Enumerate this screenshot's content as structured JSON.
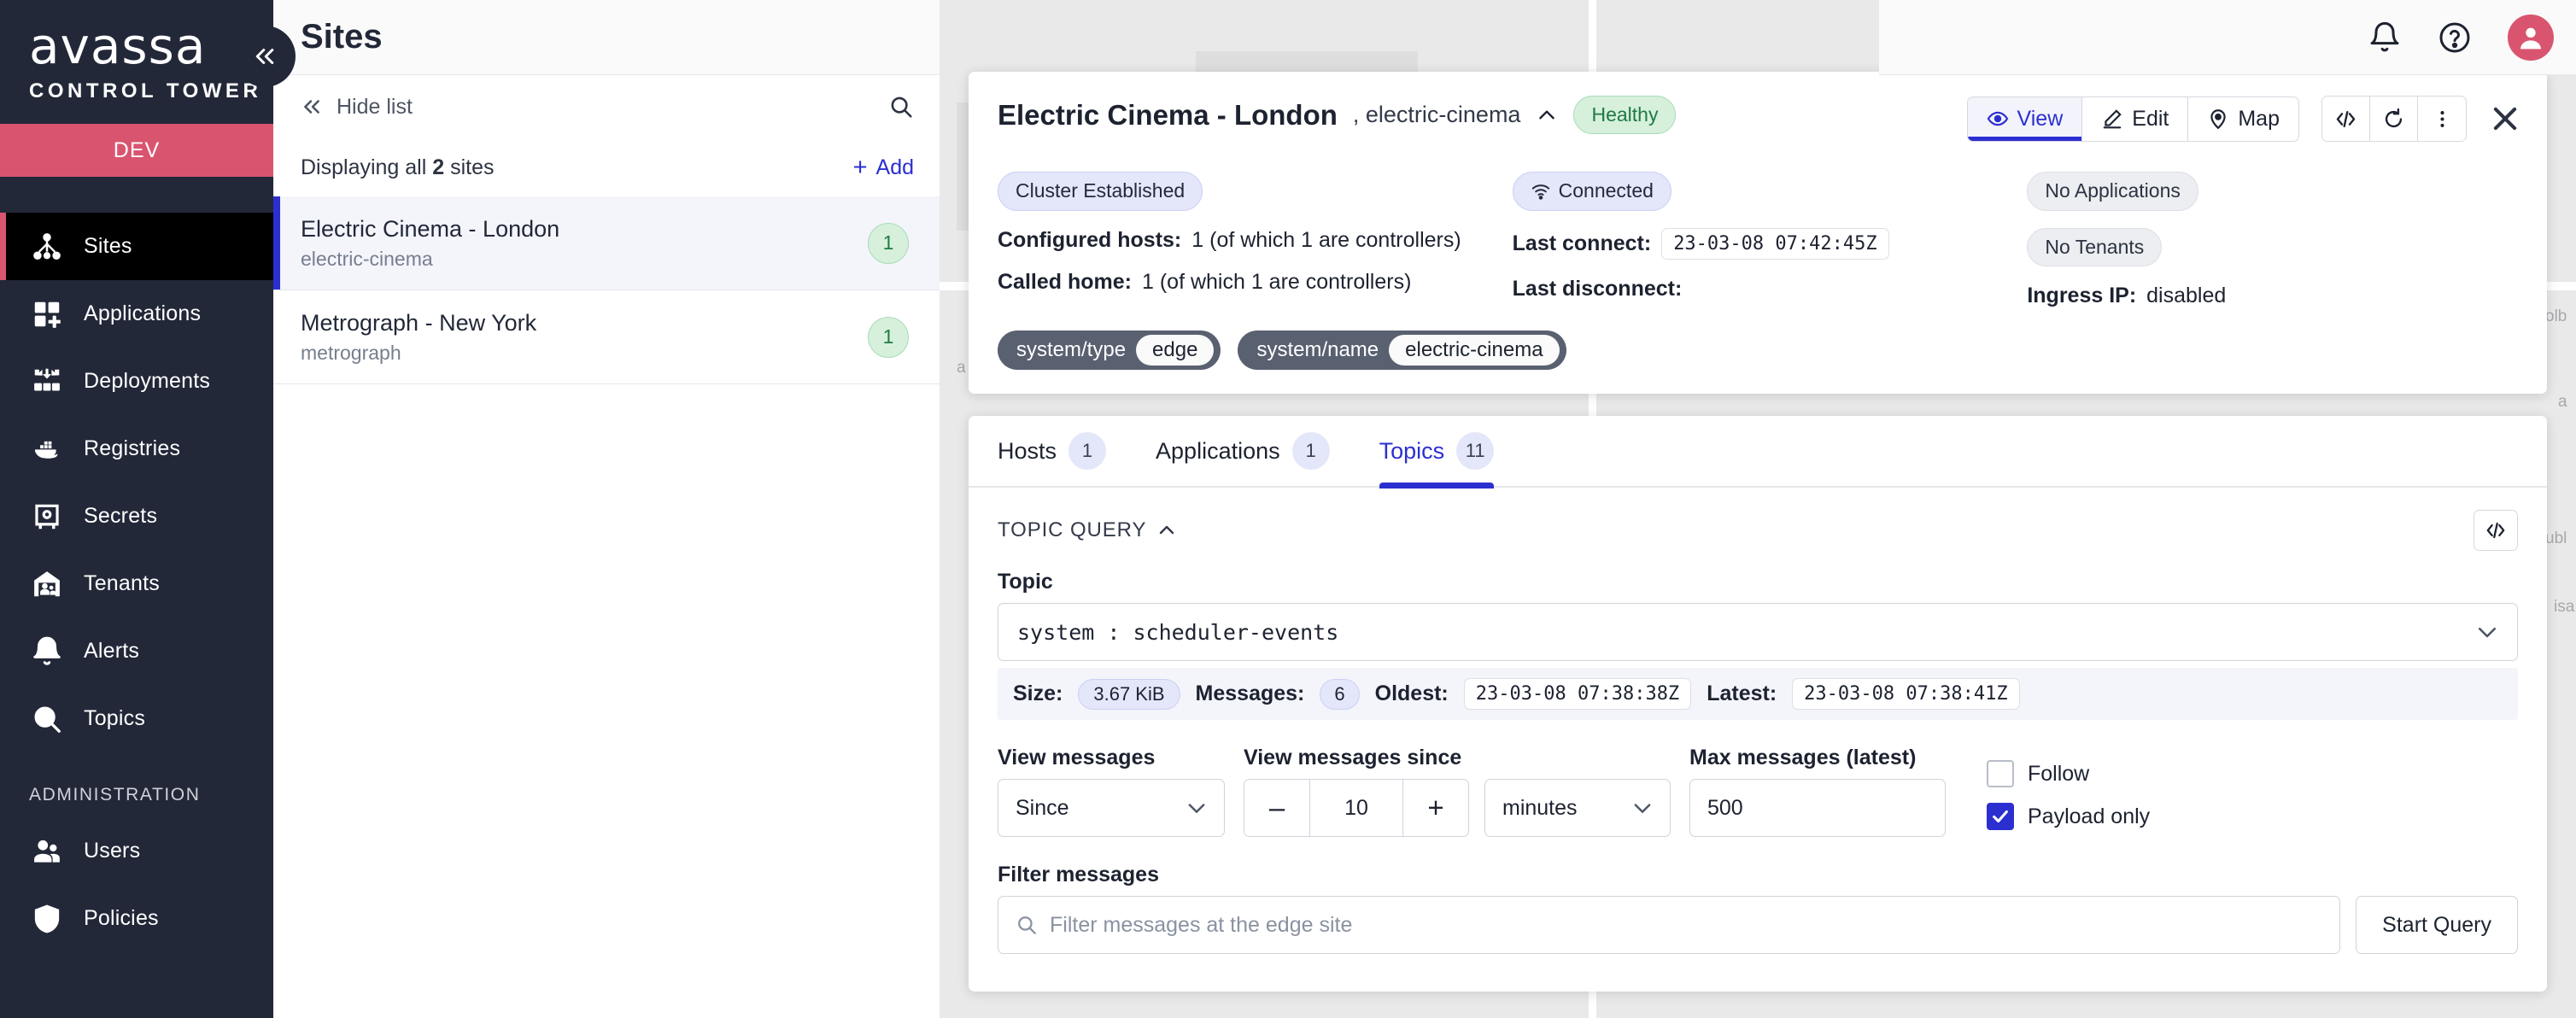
{
  "brand": {
    "logo_word": "avassa",
    "logo_sub": "CONTROL TOWER",
    "env": "DEV",
    "collapse_icon": "chevron-double-left-icon"
  },
  "sidebar": {
    "items": [
      {
        "label": "Sites",
        "icon": "sites-icon",
        "active": true
      },
      {
        "label": "Applications",
        "icon": "applications-icon",
        "active": false
      },
      {
        "label": "Deployments",
        "icon": "deployments-icon",
        "active": false
      },
      {
        "label": "Registries",
        "icon": "docker-whale-icon",
        "active": false
      },
      {
        "label": "Secrets",
        "icon": "safe-icon",
        "active": false
      },
      {
        "label": "Tenants",
        "icon": "tenants-icon",
        "active": false
      },
      {
        "label": "Alerts",
        "icon": "bell-icon",
        "active": false
      },
      {
        "label": "Topics",
        "icon": "magnifier-icon",
        "active": false
      }
    ],
    "admin_heading": "ADMINISTRATION",
    "admin_items": [
      {
        "label": "Users",
        "icon": "users-icon"
      },
      {
        "label": "Policies",
        "icon": "shield-search-icon"
      }
    ]
  },
  "header": {
    "title": "Sites",
    "notifications_icon": "bell-icon",
    "help_icon": "question-circle-icon",
    "avatar_icon": "user-avatar-icon"
  },
  "list_pane": {
    "hide_list_label": "Hide list",
    "hide_list_icon": "chevron-double-left-icon",
    "search_icon": "search-icon",
    "displaying_prefix": "Displaying all",
    "displaying_count": "2",
    "displaying_suffix": "sites",
    "add_label": "Add",
    "add_icon": "plus-icon",
    "rows": [
      {
        "name": "Electric Cinema - London",
        "slug": "electric-cinema",
        "badge": "1",
        "selected": true
      },
      {
        "name": "Metrograph - New York",
        "slug": "metrograph",
        "badge": "1",
        "selected": false
      }
    ]
  },
  "detail": {
    "title": "Electric Cinema - London",
    "subtitle": ", electric-cinema",
    "collapse_icon": "chevron-up-icon",
    "status_badge": "Healthy",
    "actions": {
      "view_label": "View",
      "view_icon": "eye-icon",
      "edit_label": "Edit",
      "edit_icon": "pencil-icon",
      "map_label": "Map",
      "map_icon": "map-pin-icon",
      "code_icon": "code-brackets-icon",
      "refresh_icon": "refresh-icon",
      "kebab_icon": "dots-vertical-icon",
      "close_icon": "close-icon"
    },
    "col1": {
      "pill": "Cluster Established",
      "configured_hosts_key": "Configured hosts:",
      "configured_hosts_value": "1 (of which 1 are controllers)",
      "called_home_key": "Called home:",
      "called_home_value": "1 (of which 1 are controllers)"
    },
    "col2": {
      "pill": "Connected",
      "pill_icon": "wifi-icon",
      "last_connect_key": "Last connect:",
      "last_connect_value": "23-03-08 07:42:45Z",
      "last_disconnect_key": "Last disconnect:",
      "last_disconnect_value": ""
    },
    "col3": {
      "pill_apps": "No Applications",
      "pill_tenants": "No Tenants",
      "ingress_key": "Ingress IP:",
      "ingress_value": "disabled"
    },
    "tags": [
      {
        "key": "system/type",
        "value": "edge"
      },
      {
        "key": "system/name",
        "value": "electric-cinema"
      }
    ]
  },
  "tabs": [
    {
      "label": "Hosts",
      "badge": "1",
      "active": false
    },
    {
      "label": "Applications",
      "badge": "1",
      "active": false
    },
    {
      "label": "Topics",
      "badge": "11",
      "active": true
    }
  ],
  "topic_query": {
    "section_title": "TOPIC QUERY",
    "section_chevron_icon": "chevron-up-icon",
    "code_icon": "code-brackets-icon",
    "topic_label": "Topic",
    "topic_value": "system : scheduler-events",
    "topic_chevron_icon": "chevron-down-icon",
    "stats": {
      "size_key": "Size:",
      "size_value": "3.67 KiB",
      "messages_key": "Messages:",
      "messages_value": "6",
      "oldest_key": "Oldest:",
      "oldest_value": "23-03-08 07:38:38Z",
      "latest_key": "Latest:",
      "latest_value": "23-03-08 07:38:41Z"
    },
    "view_messages_label": "View messages",
    "view_messages_value": "Since",
    "view_since_label": "View messages since",
    "step_minus": "–",
    "step_value": "10",
    "step_plus": "+",
    "unit_value": "minutes",
    "max_messages_label": "Max messages (latest)",
    "max_messages_value": "500",
    "follow_label": "Follow",
    "follow_checked": false,
    "payload_only_label": "Payload only",
    "payload_only_checked": true,
    "filter_label": "Filter messages",
    "filter_placeholder": "Filter messages at the edge site",
    "filter_icon": "search-icon",
    "start_query_label": "Start Query"
  },
  "colors": {
    "sidebar_bg": "#222838",
    "env_band": "#d9556f",
    "accent_blue": "#2b2fd0",
    "green_badge_bg": "#d6f0dc",
    "green_badge_text": "#1f7a44"
  }
}
